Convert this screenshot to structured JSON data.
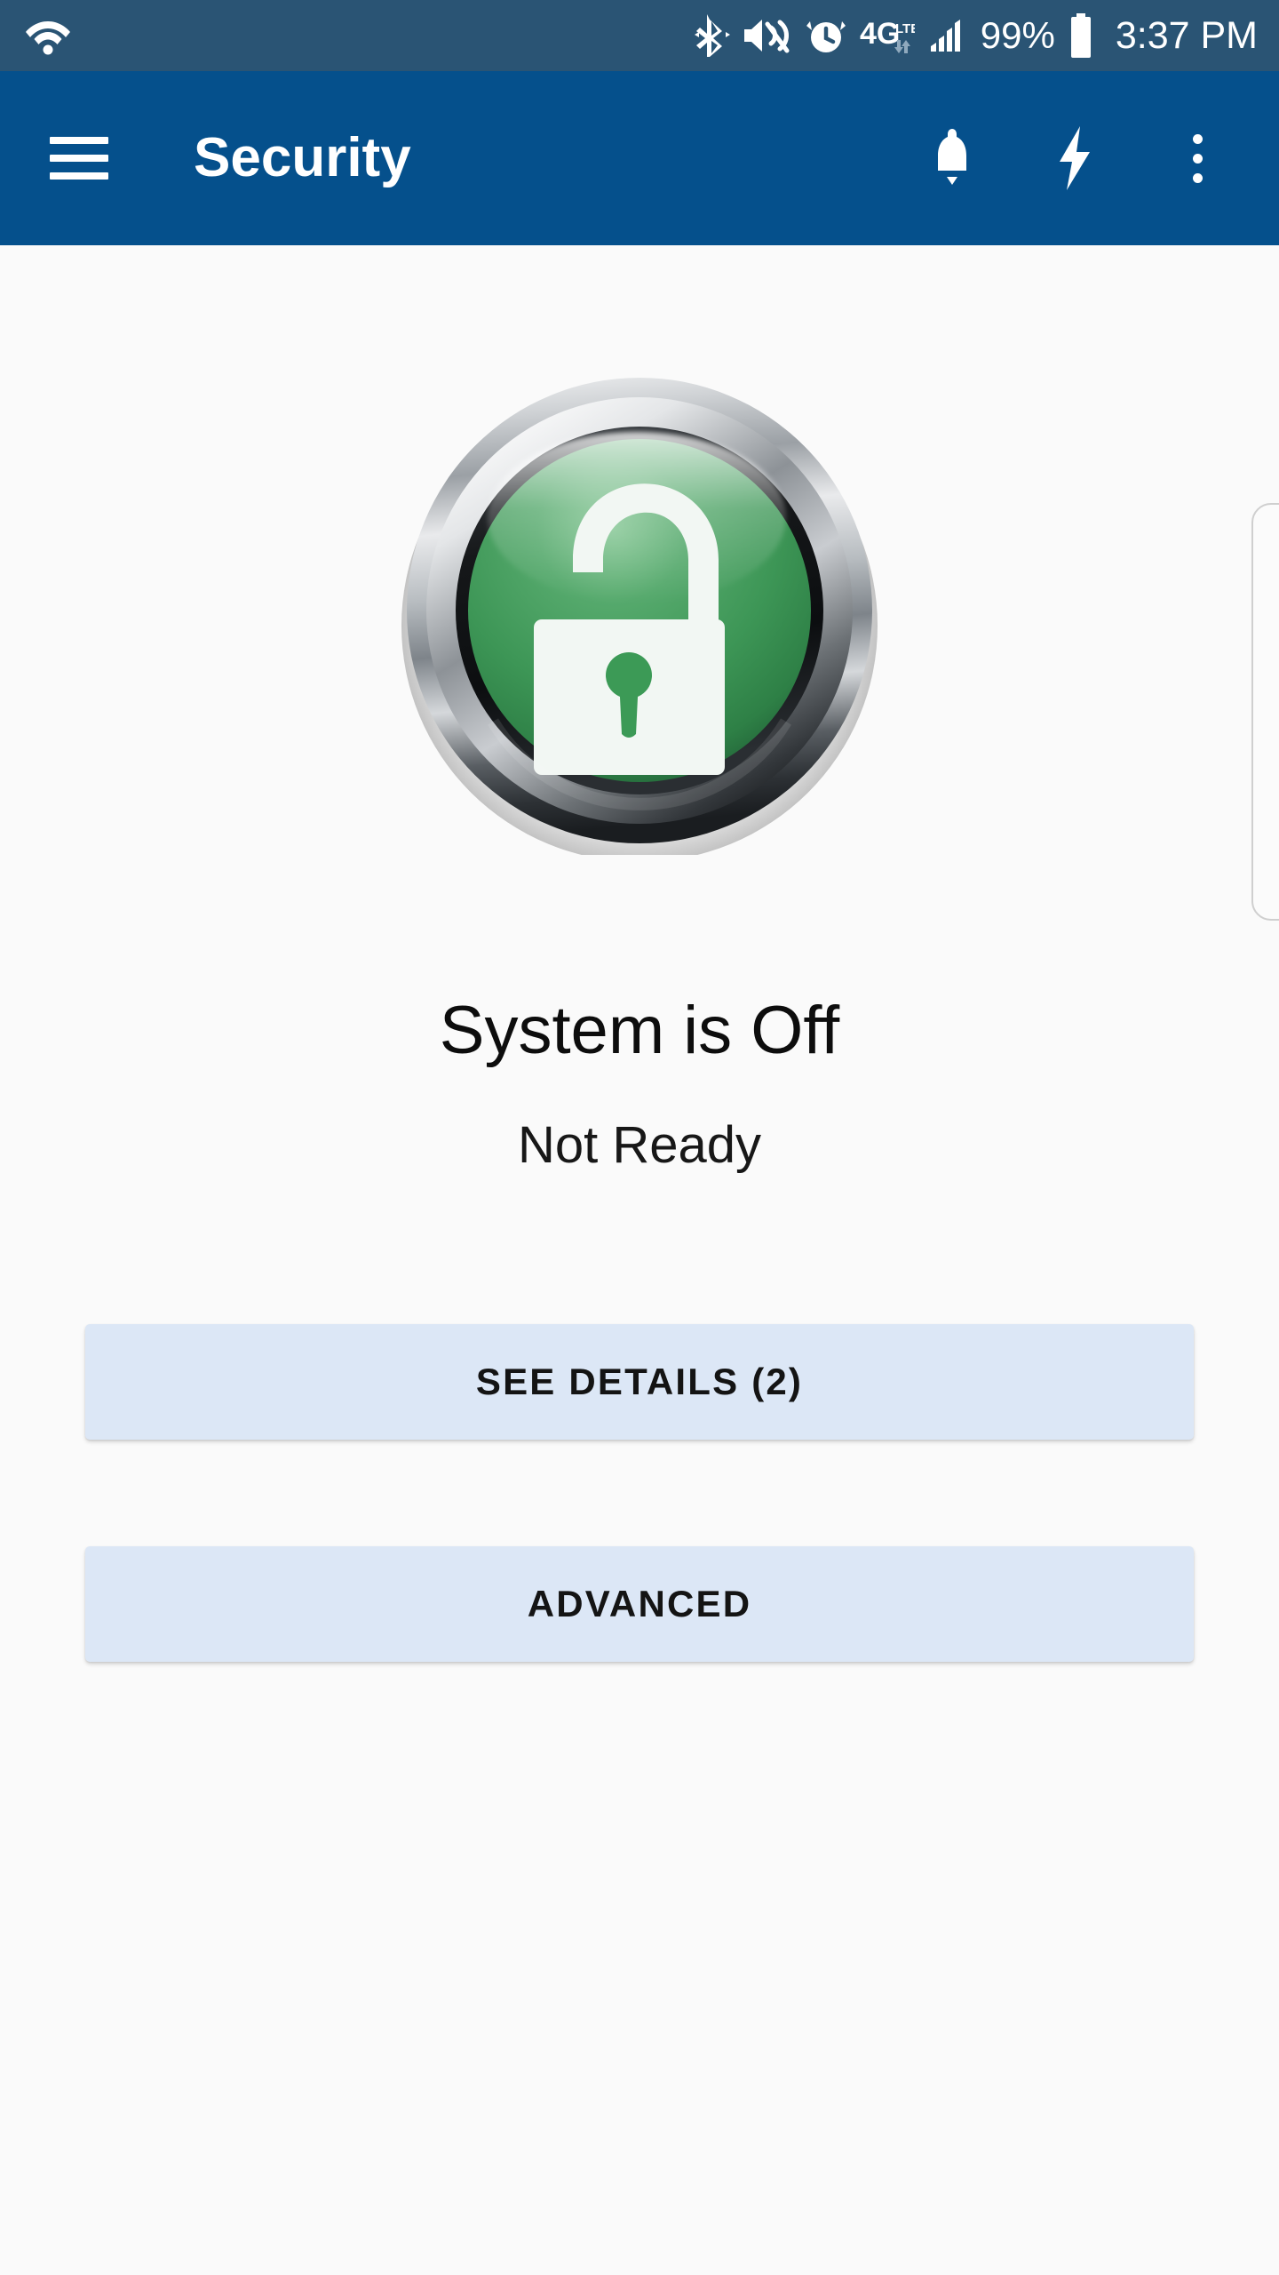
{
  "status_bar": {
    "background_color": "#2a5474",
    "wifi_icon": "wifi-icon",
    "bluetooth_icon": "bluetooth-icon",
    "vibrate_icon": "vibrate-mute-icon",
    "alarm_icon": "alarm-clock-icon",
    "network_label": "4G",
    "network_sub_label": "LTE",
    "signal_icon": "cellular-signal-icon",
    "battery_percent": "99%",
    "battery_icon": "battery-full-icon",
    "time": "3:37 PM"
  },
  "app_bar": {
    "background_color": "#05508c",
    "menu_icon": "hamburger-menu-icon",
    "title": "Security",
    "actions": [
      {
        "name": "notifications-bell-icon",
        "label": "Notifications"
      },
      {
        "name": "lightning-bolt-icon",
        "label": "Quick Action"
      },
      {
        "name": "overflow-menu-icon",
        "label": "More options"
      }
    ]
  },
  "main": {
    "background_color": "#fafafa",
    "arm_button": {
      "name": "security-system-toggle-button",
      "icon": "open-padlock-icon",
      "state": "disarmed",
      "color": "#3c9a56",
      "bezel_color": "#b8bcc0"
    },
    "status_title": "System is Off",
    "status_subtitle": "Not Ready",
    "buttons": [
      {
        "id": "see-details",
        "label": "SEE DETAILS (2)",
        "count": 2,
        "color": "#dce7f6"
      },
      {
        "id": "advanced",
        "label": "ADVANCED",
        "color": "#dce7f6"
      }
    ],
    "edge_panel": {
      "name": "offscreen-panel-edge"
    }
  }
}
